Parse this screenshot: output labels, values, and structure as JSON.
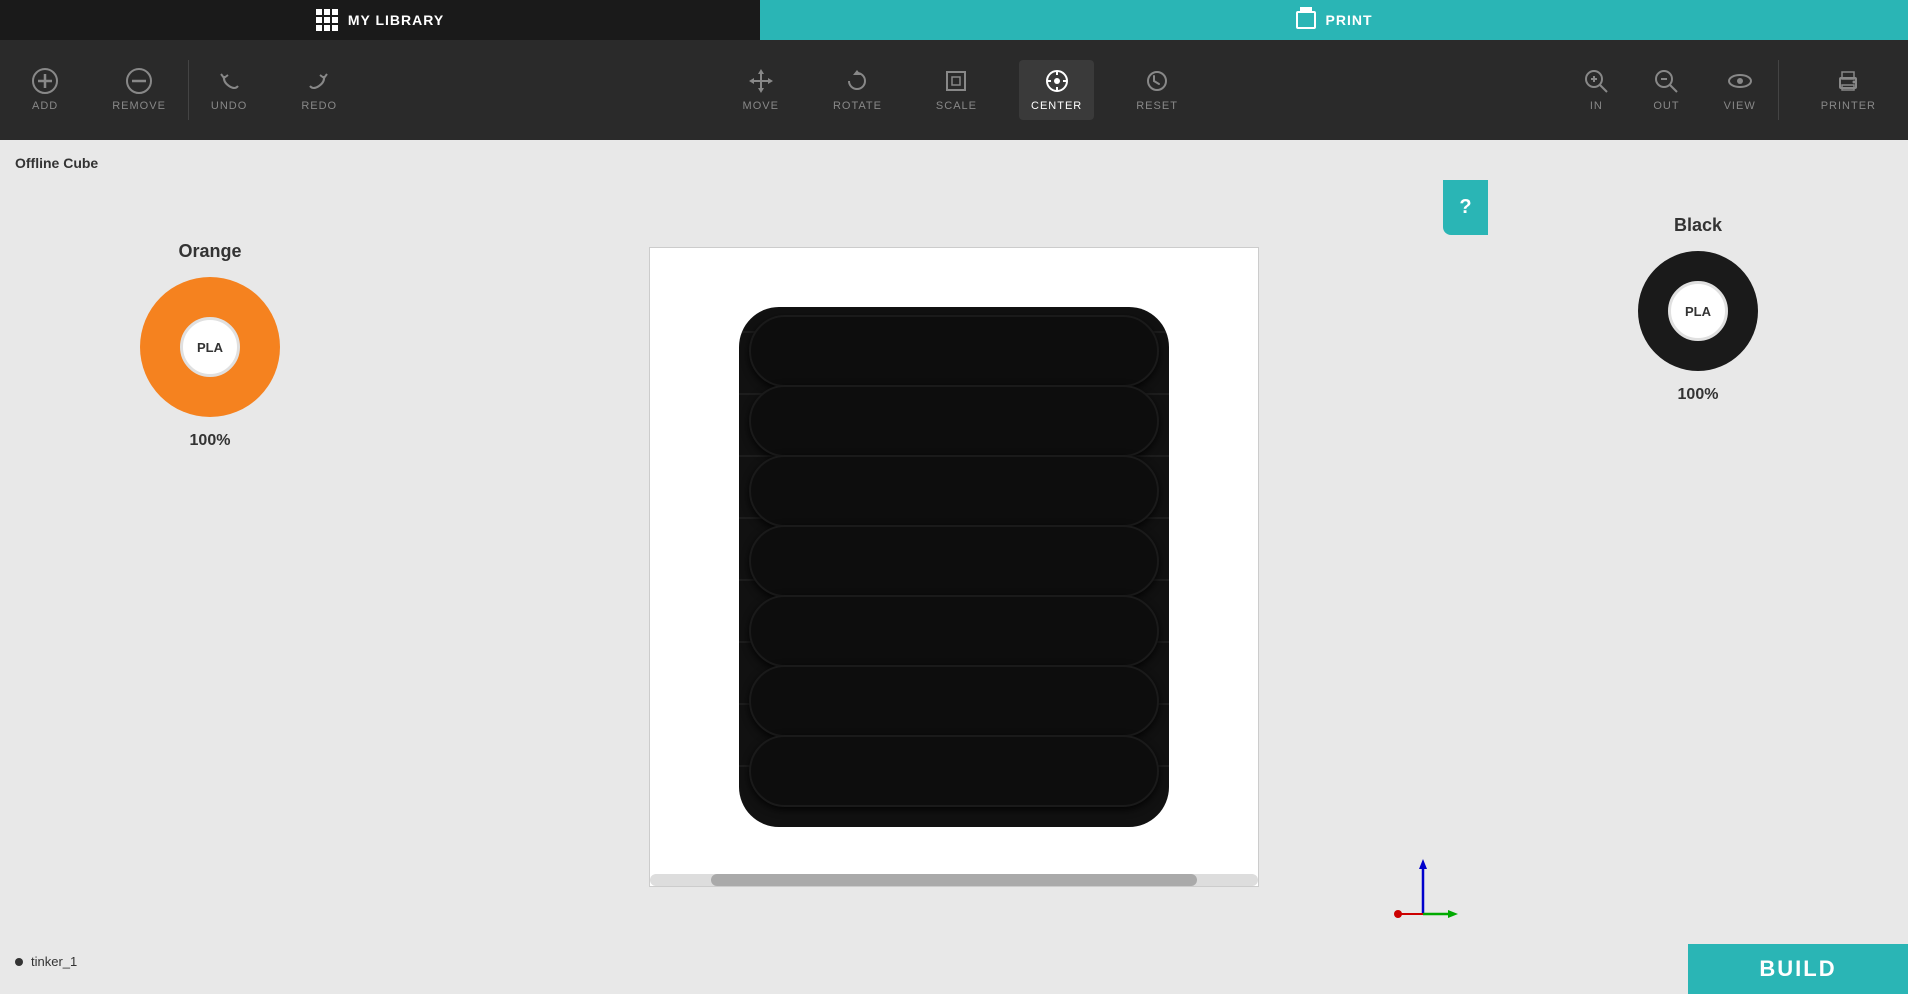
{
  "header": {
    "library_label": "MY LIBRARY",
    "print_label": "PRINT"
  },
  "toolbar": {
    "add_label": "ADD",
    "remove_label": "REMOVE",
    "undo_label": "UNDO",
    "redo_label": "REDO",
    "move_label": "MOVE",
    "rotate_label": "ROTATE",
    "scale_label": "SCALE",
    "center_label": "CENTER",
    "reset_label": "RESET",
    "in_label": "IN",
    "out_label": "OUT",
    "view_label": "VIEW",
    "printer_label": "PRINTER"
  },
  "left_panel": {
    "title": "Offline Cube",
    "filament_name": "Orange",
    "filament_type": "PLA",
    "filament_percent": "100%"
  },
  "right_panel": {
    "filament_name": "Black",
    "filament_type": "PLA",
    "filament_percent": "100%"
  },
  "object_list": {
    "items": [
      {
        "name": "tinker_1"
      }
    ]
  },
  "build_button": {
    "label": "BUILD"
  },
  "help_button": {
    "label": "?"
  },
  "colors": {
    "teal": "#2ab5b5",
    "orange": "#f5821f",
    "black": "#1a1a1a",
    "toolbar_bg": "#2a2a2a",
    "header_bg": "#1a1a1a"
  }
}
